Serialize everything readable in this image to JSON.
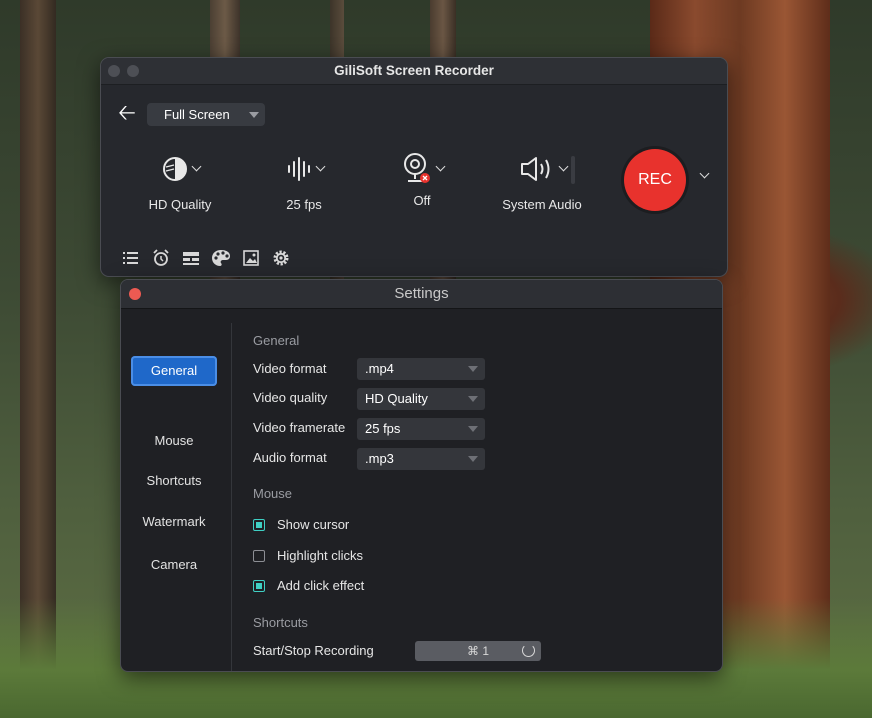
{
  "recorder": {
    "title": "GiliSoft Screen Recorder",
    "mode_select": "Full Screen",
    "controls": {
      "quality": "HD Quality",
      "framerate": "25 fps",
      "webcam": "Off",
      "audio": "System Audio"
    },
    "rec_button": "REC",
    "toolbar_icons": [
      "list-icon",
      "alarm-clock-icon",
      "timer-icon",
      "palette-icon",
      "image-icon",
      "gear-icon"
    ]
  },
  "settings": {
    "title": "Settings",
    "sidebar": [
      {
        "label": "General",
        "active": true
      },
      {
        "label": "Mouse",
        "active": false
      },
      {
        "label": "Shortcuts",
        "active": false
      },
      {
        "label": "Watermark",
        "active": false
      },
      {
        "label": "Camera",
        "active": false
      }
    ],
    "general": {
      "heading": "General",
      "rows": [
        {
          "label": "Video format",
          "value": ".mp4"
        },
        {
          "label": "Video quality",
          "value": "HD Quality"
        },
        {
          "label": "Video framerate",
          "value": "25 fps"
        },
        {
          "label": "Audio format",
          "value": ".mp3"
        }
      ]
    },
    "mouse": {
      "heading": "Mouse",
      "options": [
        {
          "label": "Show cursor",
          "checked": true
        },
        {
          "label": "Highlight clicks",
          "checked": false
        },
        {
          "label": "Add click effect",
          "checked": true
        }
      ]
    },
    "shortcuts": {
      "heading": "Shortcuts",
      "rows": [
        {
          "label": "Start/Stop Recording",
          "value": "⌘ 1"
        }
      ]
    }
  },
  "colors": {
    "accent_blue": "#1f68c9",
    "rec_red": "#e8322d",
    "checkbox_teal": "#3fd0c4"
  }
}
